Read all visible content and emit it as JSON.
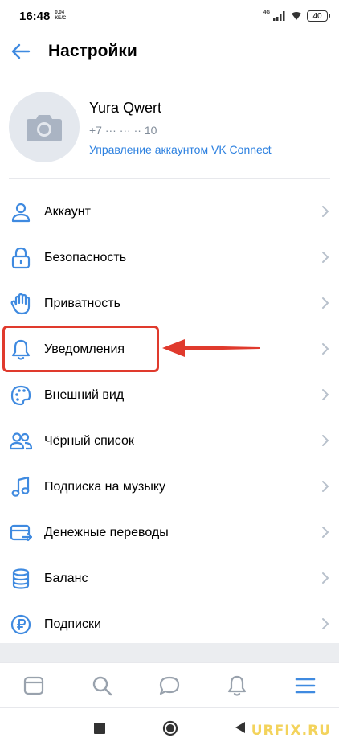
{
  "status_bar": {
    "time": "16:48",
    "speed_top": "0,04",
    "speed_bottom": "КБ/С",
    "network": "4G",
    "battery": "40"
  },
  "header": {
    "title": "Настройки",
    "back_icon": "arrow-left-icon"
  },
  "profile": {
    "name": "Yura Qwert",
    "phone": "+7 ··· ··· ·· 10",
    "manage_link": "Управление аккаунтом VK Connect",
    "avatar_icon": "camera-icon"
  },
  "menu": {
    "items": [
      {
        "label": "Аккаунт",
        "icon": "user-icon"
      },
      {
        "label": "Безопасность",
        "icon": "lock-icon"
      },
      {
        "label": "Приватность",
        "icon": "hand-icon"
      },
      {
        "label": "Уведомления",
        "icon": "bell-icon"
      },
      {
        "label": "Внешний вид",
        "icon": "palette-icon"
      },
      {
        "label": "Чёрный список",
        "icon": "users-icon"
      },
      {
        "label": "Подписка на музыку",
        "icon": "music-icon"
      },
      {
        "label": "Денежные переводы",
        "icon": "money-transfer-icon"
      },
      {
        "label": "Баланс",
        "icon": "coins-icon"
      },
      {
        "label": "Подписки",
        "icon": "ruble-icon"
      }
    ]
  },
  "tabbar": {
    "tabs": [
      "news-icon",
      "search-icon",
      "messages-icon",
      "notifications-icon",
      "menu-icon"
    ]
  },
  "watermark": "URFIX.RU",
  "colors": {
    "accent": "#2d81e0",
    "icon": "#3f8ae0",
    "highlight": "#e03a2d"
  }
}
